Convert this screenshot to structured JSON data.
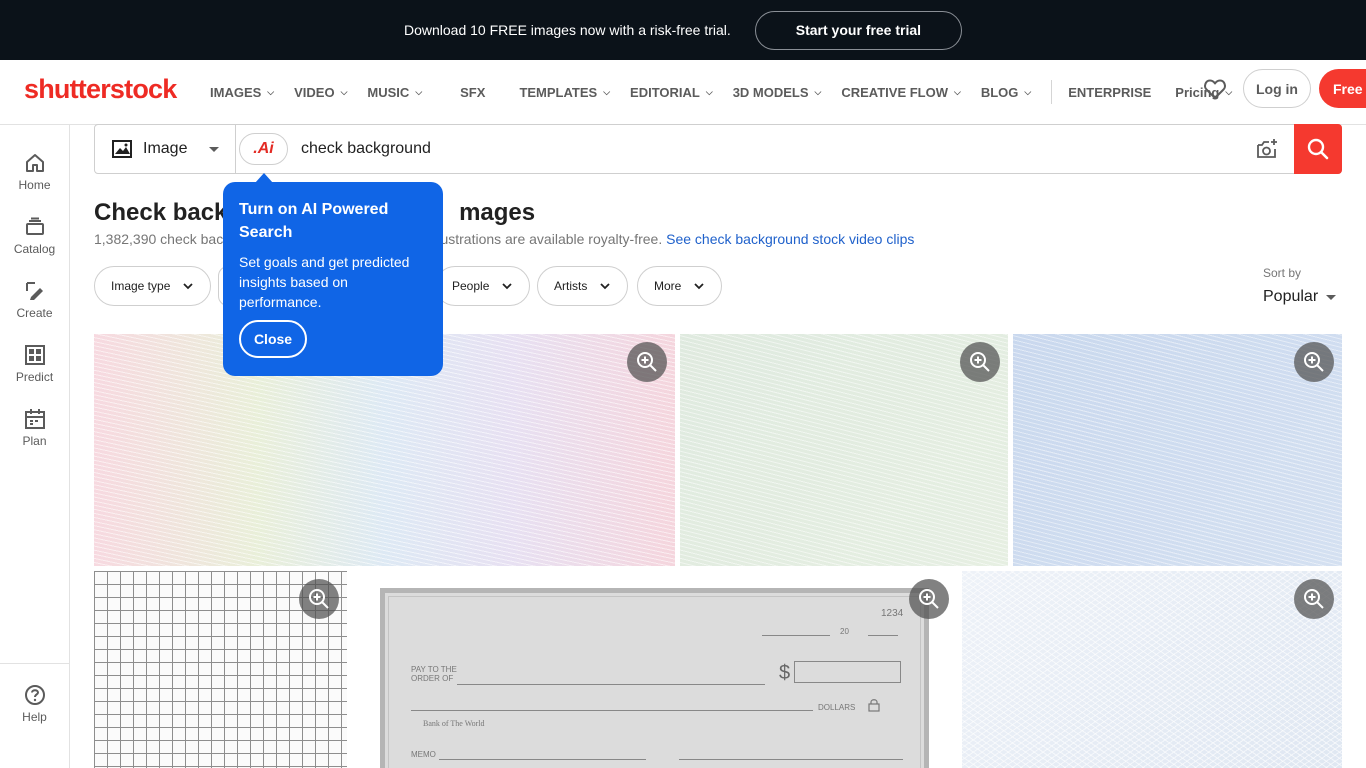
{
  "promo": {
    "text": "Download 10 FREE images now with a risk-free trial.",
    "cta": "Start your free trial"
  },
  "header": {
    "logo": "shutterstock",
    "nav": [
      {
        "label": "IMAGES",
        "dropdown": true
      },
      {
        "label": "VIDEO",
        "dropdown": true
      },
      {
        "label": "MUSIC",
        "dropdown": true
      },
      {
        "label": "SFX",
        "dropdown": false
      },
      {
        "label": "TEMPLATES",
        "dropdown": true
      },
      {
        "label": "EDITORIAL",
        "dropdown": true
      },
      {
        "label": "3D MODELS",
        "dropdown": true
      },
      {
        "label": "CREATIVE FLOW",
        "dropdown": true
      },
      {
        "label": "BLOG",
        "dropdown": true
      },
      {
        "label": "ENTERPRISE",
        "dropdown": false
      },
      {
        "label": "Pricing",
        "dropdown": true
      }
    ],
    "login": "Log in",
    "free_trial": "Free t"
  },
  "sidebar": {
    "items": [
      {
        "label": "Home",
        "icon": "home-icon"
      },
      {
        "label": "Catalog",
        "icon": "catalog-icon"
      },
      {
        "label": "Create",
        "icon": "create-icon"
      },
      {
        "label": "Predict",
        "icon": "predict-icon"
      },
      {
        "label": "Plan",
        "icon": "plan-icon"
      }
    ],
    "help": "Help"
  },
  "search": {
    "type": "Image",
    "ai_badge": ".Ai",
    "query": "check background"
  },
  "results": {
    "title_start": "Check backg",
    "title_end": "mages",
    "subtitle_start": "1,382,390 check bac",
    "subtitle_mid": "llustrations are available royalty-free.",
    "video_link": "See check background stock video clips"
  },
  "filters": [
    {
      "label": "Image type"
    },
    {
      "label": "People"
    },
    {
      "label": "Artists"
    },
    {
      "label": "More"
    }
  ],
  "sort": {
    "label": "Sort by",
    "value": "Popular"
  },
  "check_image": {
    "number": "1234",
    "date_suffix": "20",
    "pay_to_1": "PAY TO THE",
    "pay_to_2": "ORDER OF",
    "dollar_sign": "$",
    "dollars": "DOLLARS",
    "bank": "Bank of The World",
    "memo": "MEMO"
  },
  "tooltip": {
    "title": "Turn on AI Powered Search",
    "body": "Set goals and get predicted insights based on performance.",
    "close": "Close"
  },
  "colors": {
    "brand_red": "#ee2b24",
    "cta_red": "#f5392f",
    "tooltip_blue": "#1065e6",
    "link_blue": "#1f61cb",
    "promo_bg": "#0b1219"
  }
}
